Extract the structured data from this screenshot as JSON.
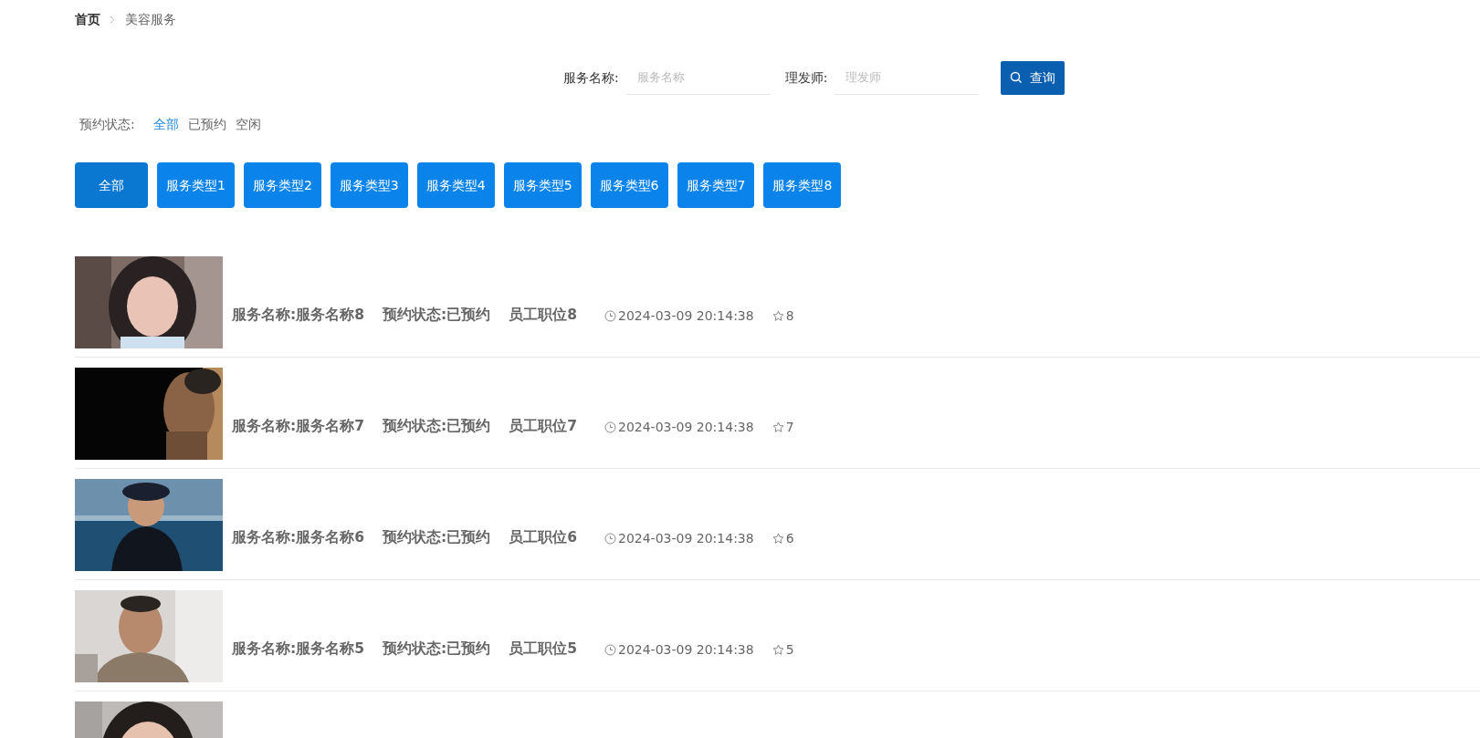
{
  "breadcrumb": [
    {
      "label": "首页",
      "current": false
    },
    {
      "label": "美容服务",
      "current": true
    }
  ],
  "search": {
    "fields": [
      {
        "label": "服务名称:",
        "placeholder": "服务名称"
      },
      {
        "label": "理发师:",
        "placeholder": "理发师"
      }
    ],
    "button": "查询"
  },
  "status_filter": {
    "label": "预约状态:",
    "options": [
      {
        "label": "全部",
        "selected": true
      },
      {
        "label": "已预约",
        "selected": false
      },
      {
        "label": "空闲",
        "selected": false
      }
    ]
  },
  "categories": [
    {
      "label": "全部",
      "selected": true
    },
    {
      "label": "服务类型1",
      "selected": false
    },
    {
      "label": "服务类型2",
      "selected": false
    },
    {
      "label": "服务类型3",
      "selected": false
    },
    {
      "label": "服务类型4",
      "selected": false
    },
    {
      "label": "服务类型5",
      "selected": false
    },
    {
      "label": "服务类型6",
      "selected": false
    },
    {
      "label": "服务类型7",
      "selected": false
    },
    {
      "label": "服务类型8",
      "selected": false
    }
  ],
  "items": [
    {
      "kind": "full",
      "name": "服务名称:服务名称8",
      "status": "预约状态:已预约",
      "position": "员工职位8",
      "time": "2024-03-09 20:14:38",
      "favorites": "8"
    },
    {
      "kind": "full",
      "name": "服务名称:服务名称7",
      "status": "预约状态:已预约",
      "position": "员工职位7",
      "time": "2024-03-09 20:14:38",
      "favorites": "7"
    },
    {
      "kind": "full",
      "name": "服务名称:服务名称6",
      "status": "预约状态:已预约",
      "position": "员工职位6",
      "time": "2024-03-09 20:14:38",
      "favorites": "6"
    },
    {
      "kind": "full",
      "name": "服务名称:服务名称5",
      "status": "预约状态:已预约",
      "position": "员工职位5",
      "time": "2024-03-09 20:14:38",
      "favorites": "5"
    },
    {
      "kind": "partial"
    }
  ]
}
